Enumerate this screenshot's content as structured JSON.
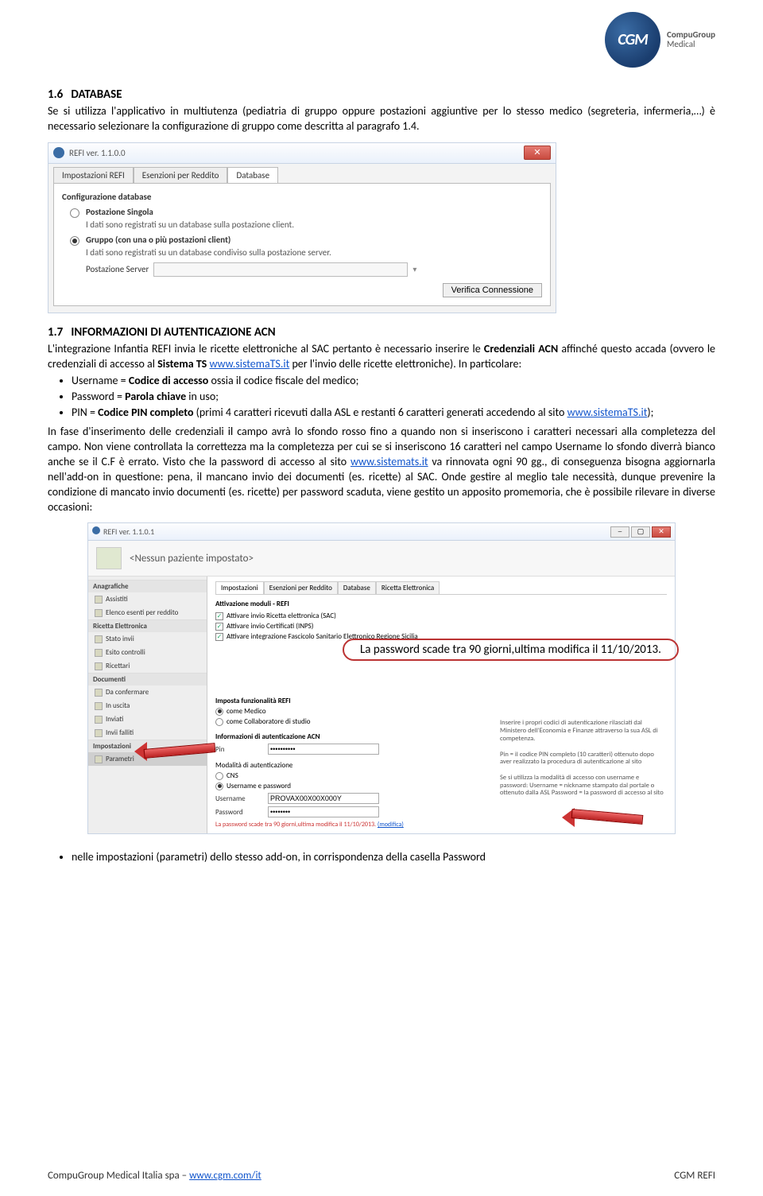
{
  "logo": {
    "abbr": "CGM",
    "name1": "CompuGroup",
    "name2": "Medical"
  },
  "sec16": {
    "num": "1.6",
    "title": "DATABASE",
    "body": "Se si utilizza l'applicativo in multiutenza (pediatria di gruppo oppure postazioni aggiuntive per lo stesso medico (segreteria, infermeria,…) è necessario selezionare la configurazione di gruppo come descritta al paragrafo 1.4."
  },
  "dlg1": {
    "title": "REFI ver. 1.1.0.0",
    "tabs": [
      "Impostazioni REFI",
      "Esenzioni per Reddito",
      "Database"
    ],
    "fieldset": "Configurazione database",
    "opt1_title": "Postazione Singola",
    "opt1_desc": "I dati sono registrati su un database sulla postazione client.",
    "opt2_title": "Gruppo (con una o più postazioni client)",
    "opt2_desc": "I dati sono registrati su un database condiviso sulla postazione server.",
    "server_label": "Postazione Server",
    "verify_btn": "Verifica Connessione"
  },
  "sec17": {
    "num": "1.7",
    "title": "INFORMAZIONI DI AUTENTICAZIONE ACN",
    "p1_a": "L'integrazione Infantia REFI invia le ricette elettroniche al SAC pertanto è necessario inserire le ",
    "p1_b": "Credenziali ACN",
    "p1_c": " affinché questo accada (ovvero le credenziali di accesso al ",
    "p1_d": "Sistema TS",
    "p1_e": " ",
    "link1": "www.sistemaTS.it",
    "p1_f": " per l'invio delle ricette elettroniche). In particolare:",
    "bul1_a": "Username = ",
    "bul1_b": "Codice di accesso",
    "bul1_c": " ossia il codice fiscale del medico;",
    "bul2_a": "Password = ",
    "bul2_b": "Parola chiave",
    "bul2_c": " in uso;",
    "bul3_a": "PIN = ",
    "bul3_b": "Codice PIN completo",
    "bul3_c": " (primi 4 caratteri ricevuti dalla ASL e restanti 6 caratteri generati accedendo al sito ",
    "bul3_link": "www.sistemaTS.it",
    "bul3_d": ");",
    "p2_a": "In fase d'inserimento delle credenziali il campo avrà lo sfondo rosso fino a quando non si inseriscono i caratteri necessari alla completezza del campo. Non viene controllata la correttezza ma la completezza per cui se si inseriscono 16 caratteri nel campo Username lo sfondo diverrà bianco anche se il C.F è errato. Visto che la password di accesso al sito ",
    "p2_link": "www.sistemats.it",
    "p2_b": " va rinnovata ogni 90 gg., di conseguenza bisogna aggiornarla nell'add-on in questione: pena, il mancano invio dei documenti (es. ricette) al SAC. Onde gestire al meglio tale necessità, dunque prevenire la condizione di mancato invio documenti (es. ricette) per password scaduta, viene gestito un apposito promemoria, che è possibile rilevare in diverse occasioni:"
  },
  "dlg2": {
    "title": "REFI ver. 1.1.0.1",
    "patient": "<Nessun paziente impostato>",
    "side_sec1": "Anagrafiche",
    "side_items1": [
      "Assistiti",
      "Elenco esenti per reddito"
    ],
    "side_sec2": "Ricetta Elettronica",
    "side_items2": [
      "Stato invii",
      "Esito controlli",
      "Ricettari"
    ],
    "side_sec3": "Documenti",
    "side_items3": [
      "Da confermare",
      "In uscita",
      "Inviati",
      "Invii falliti"
    ],
    "side_sec4": "Impostazioni",
    "side_items4": [
      "Parametri"
    ],
    "tabs": [
      "Impostazioni",
      "Esenzioni per Reddito",
      "Database",
      "Ricetta Elettronica"
    ],
    "panel_title": "Attivazione moduli - REFI",
    "chks": [
      "Attivare invio Ricetta elettronica (SAC)",
      "Attivare invio Certificati (INPS)",
      "Attivare integrazione Fascicolo Sanitario Elettronico Regione Sicilia"
    ],
    "bubble": "La password scade tra 90 giorni,ultima modifica il 11/10/2013.",
    "imposta_label": "Imposta funzionalità REFI",
    "imposta_opts": [
      "come Medico",
      "come Collaboratore di studio"
    ],
    "auth_label": "Informazioni di autenticazione ACN",
    "pin_label": "Pin",
    "pin_value": "••••••••••",
    "mod_label": "Modalità di autenticazione",
    "mod_opts": [
      "CNS",
      "Username e password"
    ],
    "user_label": "Username",
    "user_value": "PROVAX00X00X000Y",
    "pwd_label": "Password",
    "pwd_value": "••••••••",
    "info_text": "Inserire i propri codici di autenticazione rilasciati dal Ministero dell'Economia e Finanze attraverso la sua ASL di competenza.",
    "info_text2": "Pin = il codice PIN completo (10 caratteri) ottenuto dopo aver realizzato la procedura di autenticazione al sito",
    "info_text3": "Se si utilizza la modalità di accesso con username e password: Username = nickname stampato dal portale o ottenuto dalla ASL Password = la password di accesso al sito",
    "mini_note": "La password scade tra 90 giorni,ultima modifica il 11/10/2013.",
    "mini_link": "(modifica)"
  },
  "final_bullet": "nelle impostazioni (parametri) dello stesso add-on, in corrispondenza della casella Password",
  "footer": {
    "left_a": "CompuGroup Medical Italia spa – ",
    "left_link": "www.cgm.com/it",
    "right": "CGM REFI"
  }
}
